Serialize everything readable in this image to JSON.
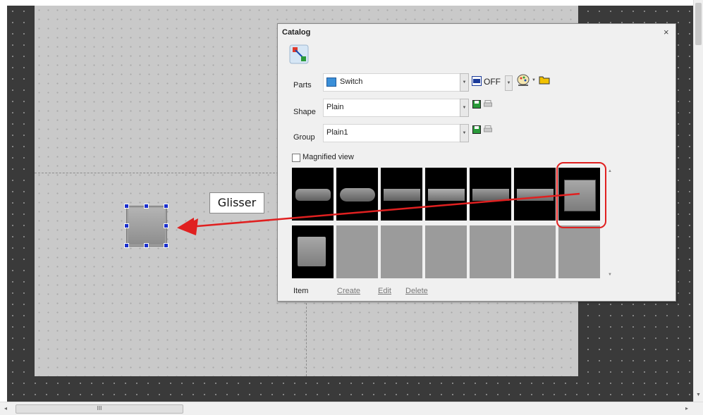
{
  "catalog": {
    "title": "Catalog",
    "close_symbol": "×",
    "parts_label": "Parts",
    "parts_value": "Switch",
    "off_label": "OFF",
    "shape_label": "Shape",
    "shape_value": "Plain",
    "group_label": "Group",
    "group_value": "Plain1",
    "magnified_label": "Magnified view",
    "magnified_checked": false,
    "item_label": "Item",
    "create_label": "Create",
    "edit_label": "Edit",
    "delete_label": "Delete"
  },
  "annotation": {
    "callout_text": "Glisser",
    "arrow_color": "#e02020"
  },
  "scrollbar": {
    "h_thumb_glyph": "III",
    "left_arrow": "◂",
    "right_arrow": "▸"
  },
  "icons": {
    "tool": "drag-tool-icon",
    "parts": "switch-part-icon",
    "off": "off-switch-icon",
    "palette": "palette-icon",
    "folder": "folder-icon",
    "save": "save-icon",
    "print": "print-icon"
  }
}
